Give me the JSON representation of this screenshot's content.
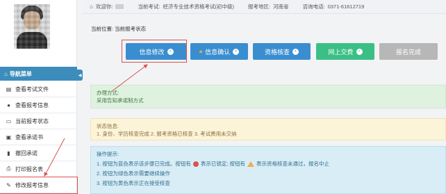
{
  "topbar": {
    "welcome": "欢迎你:",
    "exam_label": "当前考试:",
    "exam_name": "经济专业技术资格考试(初中级)",
    "province_label": "报考地区:",
    "province": "河南省",
    "phone_label": "咨询电话:",
    "phone": "0371-61612719"
  },
  "sidebar": {
    "nav_title": "导航菜单",
    "items": [
      {
        "label": "查看考试文件",
        "icon": "file-icon"
      },
      {
        "label": "查看报考信息",
        "icon": "info-icon"
      },
      {
        "label": "当前报考状态",
        "icon": "monitor-icon"
      },
      {
        "label": "查看承诺书",
        "icon": "book-icon"
      },
      {
        "label": "撤回承诺",
        "icon": "undo-icon"
      },
      {
        "label": "打印报名表",
        "icon": "print-icon"
      },
      {
        "label": "修改报考信息",
        "icon": "edit-icon"
      }
    ]
  },
  "breadcrumb": "当前位置: 当前报考状态",
  "buttons": {
    "modify": "信息修改",
    "confirm": "信息确认",
    "check": "资格核查",
    "pay": "网上交费",
    "done": "报名完成"
  },
  "colors": {
    "primary": "#3a8ed0",
    "success": "#3bbf86",
    "disabled": "#b7b7b7",
    "annotation_red": "#d9534f"
  },
  "panels": {
    "method_title": "办理方式:",
    "method_text": "采用告知承诺制方式",
    "status_title": "状态信息:",
    "status_text": "1. 身份、学历核查完成 2. 报考资格已核查 3. 考试费用未交纳",
    "tips_title": "操作提示:",
    "tip1_a": "1. 按钮为蓝色表示该步骤已完成。按钮有",
    "tip1_b": "表示已锁定; 按钮有",
    "tip1_c": "表示资格核查未通过，报名中止",
    "tip2": "2. 按钮为绿色表示需要继续操作",
    "tip3": "3. 按钮为黄色表示正在接受核查"
  }
}
